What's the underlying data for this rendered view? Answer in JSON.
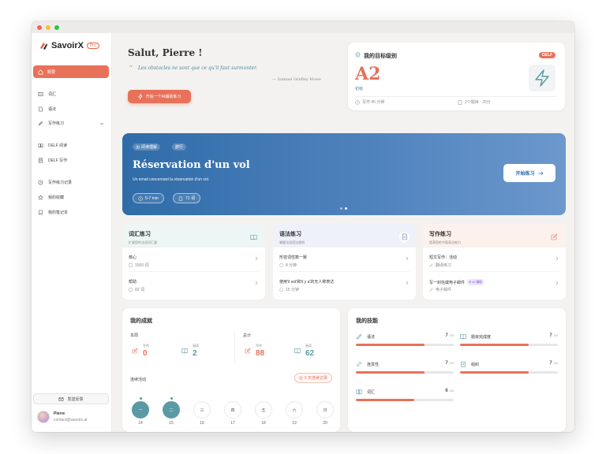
{
  "app": {
    "name": "SavoirX",
    "badge": "Pro"
  },
  "sidebar": {
    "active": {
      "label": "概要",
      "icon": "home-icon"
    },
    "items": [
      {
        "label": "词汇",
        "icon": "vocabulary-icon"
      },
      {
        "label": "语法",
        "icon": "grammar-icon"
      },
      {
        "label": "写作练习",
        "icon": "pen-icon"
      },
      {
        "label": "DELF 阅读",
        "icon": "book-icon"
      },
      {
        "label": "DELF 写作",
        "icon": "document-icon"
      },
      {
        "label": "写作练习记录",
        "icon": "history-icon"
      },
      {
        "label": "我的收藏",
        "icon": "star-icon"
      },
      {
        "label": "我的笔记本",
        "icon": "bookmark-icon"
      }
    ],
    "feedback_label": "发送反馈",
    "user": {
      "name": "Pierre",
      "email": "contact@savoirx.ai"
    }
  },
  "hero": {
    "greeting": "Salut, Pierre !",
    "quote": "Les obstacles ne sont que ce qu'il faut surmonter.",
    "author": "— Samuel Gridley Howe",
    "cta_label": "开始一个AI辅助练习"
  },
  "target": {
    "title": "我的目标级别",
    "badge": "DELF",
    "level": "A2",
    "level_sub": "初级",
    "writing_time": "写作 45 分钟",
    "tasks": "2个题目 - 25分"
  },
  "banner": {
    "tags": [
      "阅读理解",
      "旅行"
    ],
    "title": "Réservation d'un vol",
    "subtitle": "Un email concernant la réservation d'un vol.",
    "duration": "5-7 min",
    "words": "71 词",
    "start_label": "开始练习",
    "page_index": 1,
    "page_count": 2
  },
  "practice": [
    {
      "title": "词汇练习",
      "subtitle": "扩展您的法语词汇量",
      "icon": "book-open-icon",
      "color": "#5a9aa5",
      "bg": "#edf6f4",
      "rows": [
        {
          "title": "核心",
          "sub": "1500 词"
        },
        {
          "title": "帮助",
          "sub": "82 词"
        }
      ]
    },
    {
      "title": "语法练习",
      "subtitle": "掌握法语语法规则",
      "icon": "document-icon",
      "color": "#6f72c9",
      "bg": "#eef1fa",
      "rows": [
        {
          "title": "形容词性数一致",
          "sub": "8 分钟"
        },
        {
          "title": "使用'il est'和'il y a'的无人称表达",
          "sub": "15 分钟"
        }
      ]
    },
    {
      "title": "写作练习",
      "subtitle": "提高您的书面表达能力",
      "icon": "edit-icon",
      "color": "#e8715a",
      "bg": "#fdf1ed",
      "rows": [
        {
          "title": "短文写作：活动",
          "sub": "翻译练习"
        },
        {
          "title": "写一封信或电子邮件",
          "sub": "电子邮件",
          "badge": "AI 辅助"
        }
      ]
    }
  ],
  "achievements": {
    "title": "我的成就",
    "this_week": "本周",
    "total": "总计",
    "writing_label": "写作",
    "reading_label": "阅读",
    "week_writing": "0",
    "week_reading": "2",
    "total_writing": "88",
    "total_reading": "62",
    "streak_title": "连续活动",
    "streak_badge": "0 天连续记录",
    "days": [
      {
        "label": "一",
        "date": "14",
        "active": true
      },
      {
        "label": "二",
        "date": "15",
        "active": true
      },
      {
        "label": "三",
        "date": "16",
        "active": false
      },
      {
        "label": "四",
        "date": "17",
        "active": false
      },
      {
        "label": "五",
        "date": "18",
        "active": false
      },
      {
        "label": "六",
        "date": "19",
        "active": false
      },
      {
        "label": "日",
        "date": "20",
        "active": false
      }
    ]
  },
  "skills": {
    "title": "我的技能",
    "max_label": "/10",
    "items": [
      {
        "name": "语法",
        "score": 7,
        "icon": "pen-icon"
      },
      {
        "name": "题目完成度",
        "score": 7,
        "icon": "book-open-icon"
      },
      {
        "name": "连贯性",
        "score": 7,
        "icon": "link-icon"
      },
      {
        "name": "组织",
        "score": 7,
        "icon": "clipboard-icon"
      },
      {
        "name": "词汇",
        "score": 6,
        "icon": "book-icon"
      }
    ]
  }
}
